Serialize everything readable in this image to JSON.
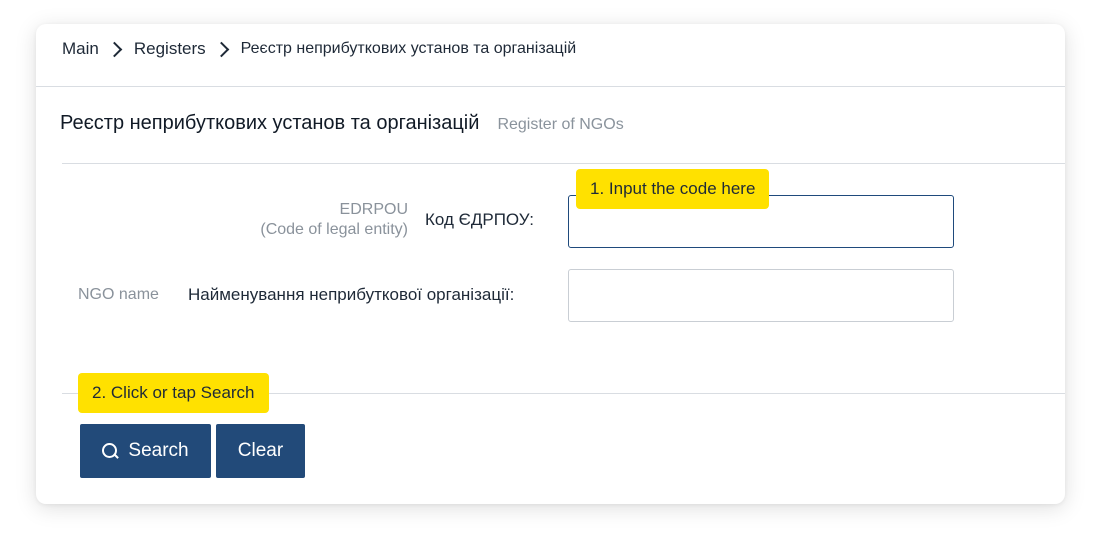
{
  "breadcrumb": {
    "items": [
      "Main",
      "Registers",
      "Реєстр неприбуткових установ та організацій"
    ]
  },
  "header": {
    "title": "Реєстр неприбуткових установ та організацій",
    "subtitle": "Register of NGOs"
  },
  "form": {
    "edrpou": {
      "label_en_line1": "EDRPOU",
      "label_en_line2": "(Code of legal entity)",
      "label_uk": "Код ЄДРПОУ:",
      "value": ""
    },
    "ngo_name": {
      "label_en": "NGO name",
      "label_uk": "Найменування неприбуткової організації:",
      "value": ""
    }
  },
  "tooltips": {
    "step1": "1. Input the code here",
    "step2": "2. Click or tap Search"
  },
  "buttons": {
    "search_label": "Search",
    "clear_label": "Clear",
    "search_icon": "search-icon"
  },
  "colors": {
    "primary": "#224a79",
    "highlight": "#ffe100"
  }
}
